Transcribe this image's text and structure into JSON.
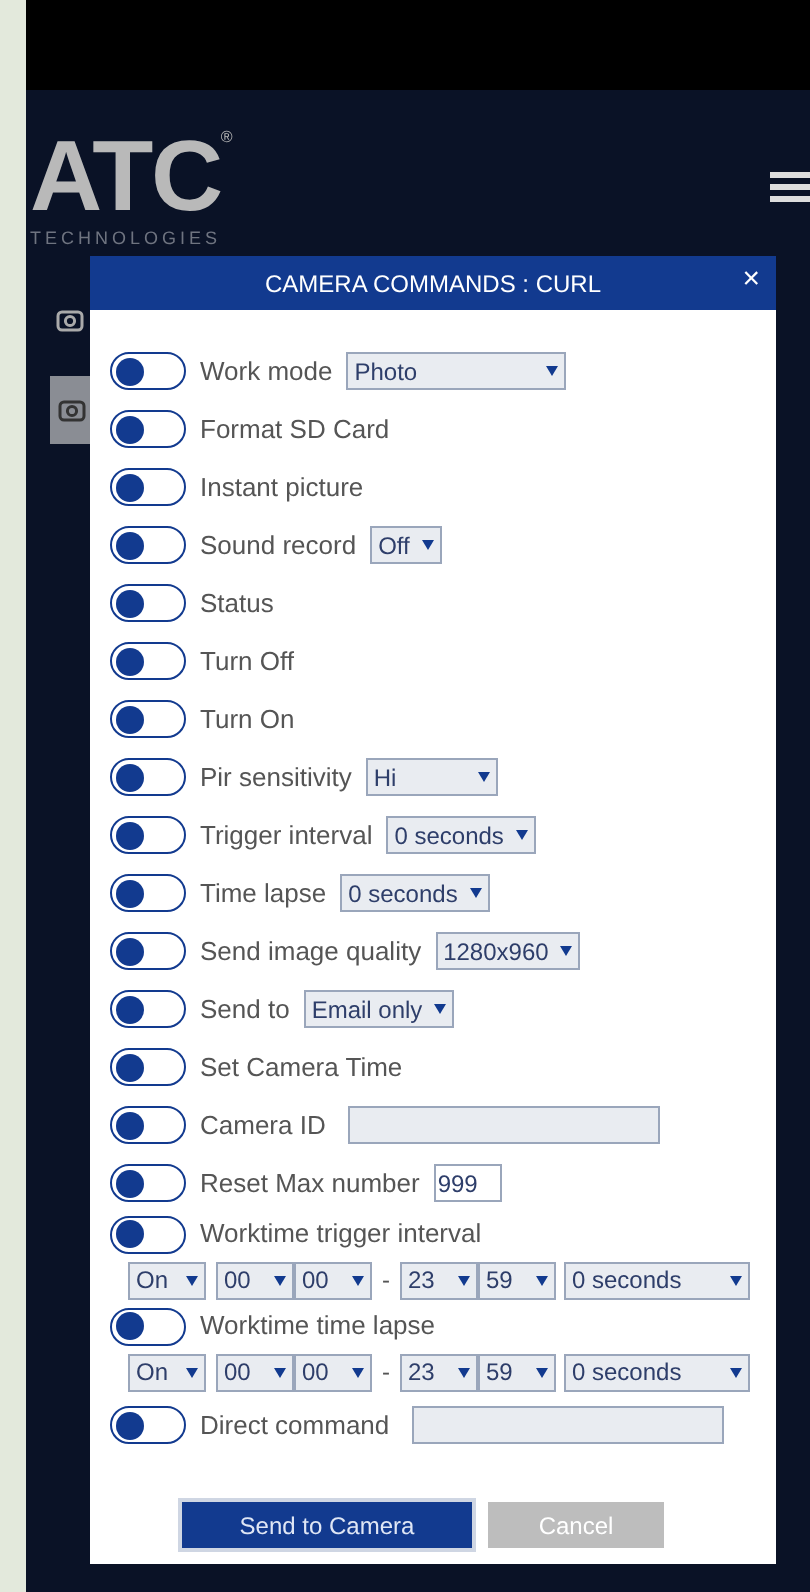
{
  "logo": {
    "name": "ATC",
    "registered": "®",
    "tagline": "TECHNOLOGIES"
  },
  "modal": {
    "title": "CAMERA COMMANDS : CURL",
    "close": "×",
    "rows": [
      {
        "label": "Work mode",
        "on": false,
        "control": {
          "kind": "select",
          "value": "Photo",
          "wide": true
        }
      },
      {
        "label": "Format SD Card",
        "on": false
      },
      {
        "label": "Instant picture",
        "on": false
      },
      {
        "label": "Sound record",
        "on": false,
        "control": {
          "kind": "select",
          "value": "Off"
        }
      },
      {
        "label": "Status",
        "on": false
      },
      {
        "label": "Turn Off",
        "on": false
      },
      {
        "label": "Turn On",
        "on": false
      },
      {
        "label": "Pir sensitivity",
        "on": false,
        "control": {
          "kind": "select",
          "value": "Hi",
          "wide": true
        }
      },
      {
        "label": "Trigger interval",
        "on": false,
        "control": {
          "kind": "select",
          "value": "0 seconds"
        }
      },
      {
        "label": "Time lapse",
        "on": false,
        "control": {
          "kind": "select",
          "value": "0 seconds"
        }
      },
      {
        "label": "Send image quality",
        "on": false,
        "control": {
          "kind": "select",
          "value": "1280x960"
        }
      },
      {
        "label": "Send to",
        "on": false,
        "control": {
          "kind": "select",
          "value": "Email only"
        }
      },
      {
        "label": "Set Camera Time",
        "on": false
      },
      {
        "label": "Camera ID",
        "on": false,
        "control": {
          "kind": "text"
        }
      },
      {
        "label": "Reset Max number",
        "on": false,
        "control": {
          "kind": "number",
          "value": "999"
        }
      },
      {
        "label": "Worktime trigger interval",
        "on": false,
        "schedule": {
          "mode": "On",
          "start_hour": "00",
          "start_minute": "00",
          "dash": "-",
          "end_hour": "23",
          "end_minute": "59",
          "interval": "0 seconds"
        }
      },
      {
        "label": "Worktime time lapse",
        "on": false,
        "schedule": {
          "mode": "On",
          "start_hour": "00",
          "start_minute": "00",
          "dash": "-",
          "end_hour": "23",
          "end_minute": "59",
          "interval": "0 seconds"
        }
      },
      {
        "label": "Direct command",
        "on": false,
        "control": {
          "kind": "text"
        }
      }
    ],
    "buttons": [
      {
        "label": "Send to Camera",
        "kind": "primary"
      },
      {
        "label": "Cancel",
        "kind": "secondary"
      }
    ]
  }
}
